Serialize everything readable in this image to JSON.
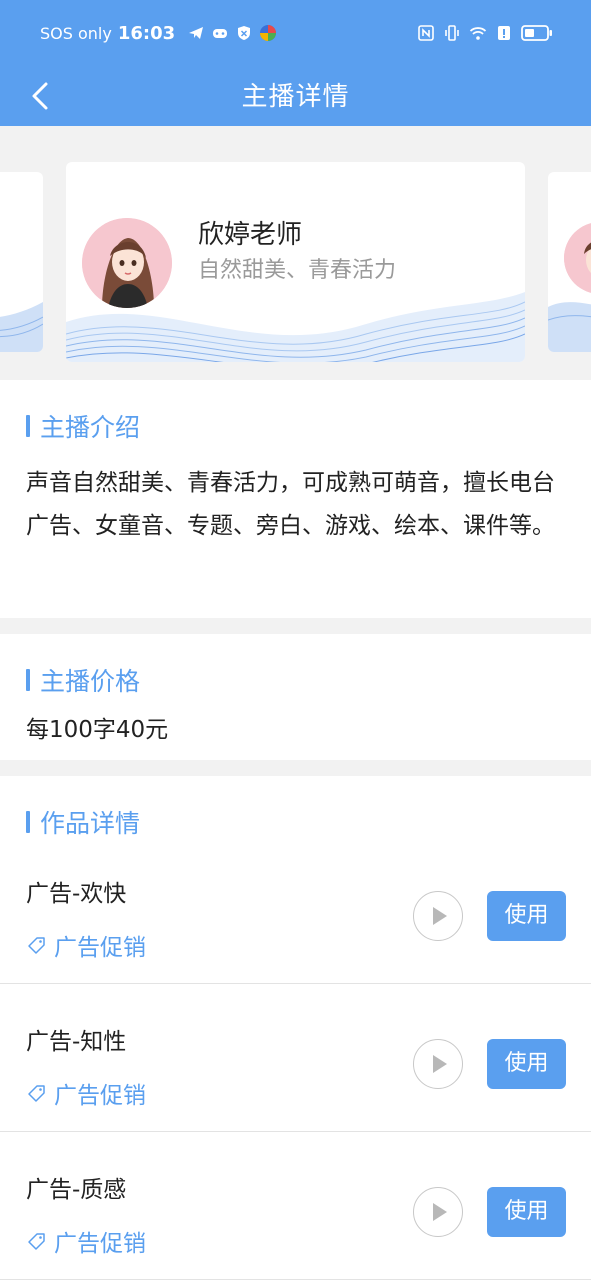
{
  "status_bar": {
    "carrier": "SOS only",
    "time": "16:03",
    "icons": [
      "telegram-icon",
      "game-controller-icon",
      "shield-icon",
      "app-icon",
      "nfc-icon",
      "vibrate-icon",
      "wifi-icon",
      "alert-icon",
      "battery-icon"
    ]
  },
  "nav": {
    "title": "主播详情",
    "back_icon": "chevron-left-icon"
  },
  "anchor_card": {
    "name": "欣婷老师",
    "tagline": "自然甜美、青春活力"
  },
  "intro": {
    "title": "主播介绍",
    "text": "声音自然甜美、青春活力，可成熟可萌音，擅长电台广告、女童音、专题、旁白、游戏、绘本、课件等。"
  },
  "price": {
    "title": "主播价格",
    "text": "每100字40元"
  },
  "works": {
    "title": "作品详情",
    "items": [
      {
        "title": "广告-欢快",
        "category": "广告促销",
        "use_label": "使用"
      },
      {
        "title": "广告-知性",
        "category": "广告促销",
        "use_label": "使用"
      },
      {
        "title": "广告-质感",
        "category": "广告促销",
        "use_label": "使用"
      }
    ]
  },
  "colors": {
    "accent": "#5a9fef",
    "background": "#f2f2f2",
    "muted_text": "#9a9a9a"
  }
}
